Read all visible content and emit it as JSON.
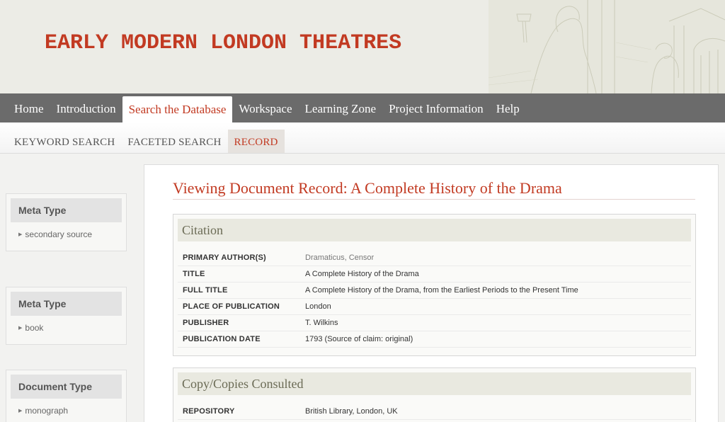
{
  "site": {
    "title": "EARLY MODERN LONDON THEATRES"
  },
  "main_nav": [
    {
      "label": "Home",
      "active": false
    },
    {
      "label": "Introduction",
      "active": false
    },
    {
      "label": "Search the Database",
      "active": true
    },
    {
      "label": "Workspace",
      "active": false
    },
    {
      "label": "Learning Zone",
      "active": false
    },
    {
      "label": "Project Information",
      "active": false
    },
    {
      "label": "Help",
      "active": false
    }
  ],
  "sub_nav": [
    {
      "label": "KEYWORD SEARCH",
      "active": false
    },
    {
      "label": "FACETED SEARCH",
      "active": false
    },
    {
      "label": "RECORD",
      "active": true
    }
  ],
  "facets": [
    {
      "title": "Meta Type",
      "value": "secondary source"
    },
    {
      "title": "Meta Type",
      "value": "book"
    },
    {
      "title": "Document Type",
      "value": "monograph"
    }
  ],
  "record": {
    "page_title": "Viewing Document Record: A Complete History of the Drama",
    "citation": {
      "heading": "Citation",
      "rows": [
        {
          "label": "PRIMARY AUTHOR(S)",
          "value": "Dramaticus, Censor"
        },
        {
          "label": "TITLE",
          "value": "A Complete History of the Drama"
        },
        {
          "label": "FULL TITLE",
          "value": "A Complete History of the Drama, from the Earliest Periods to the Present Time"
        },
        {
          "label": "PLACE OF PUBLICATION",
          "value": "London"
        },
        {
          "label": "PUBLISHER",
          "value": "T. Wilkins"
        },
        {
          "label": "PUBLICATION DATE",
          "value": "1793 (Source of claim: original)"
        }
      ]
    },
    "copies": {
      "heading": "Copy/Copies Consulted",
      "rows": [
        {
          "label": "REPOSITORY",
          "value": "British Library, London, UK"
        }
      ]
    }
  },
  "colors": {
    "accent": "#c23a22",
    "nav_bg": "#6b6b6b"
  }
}
